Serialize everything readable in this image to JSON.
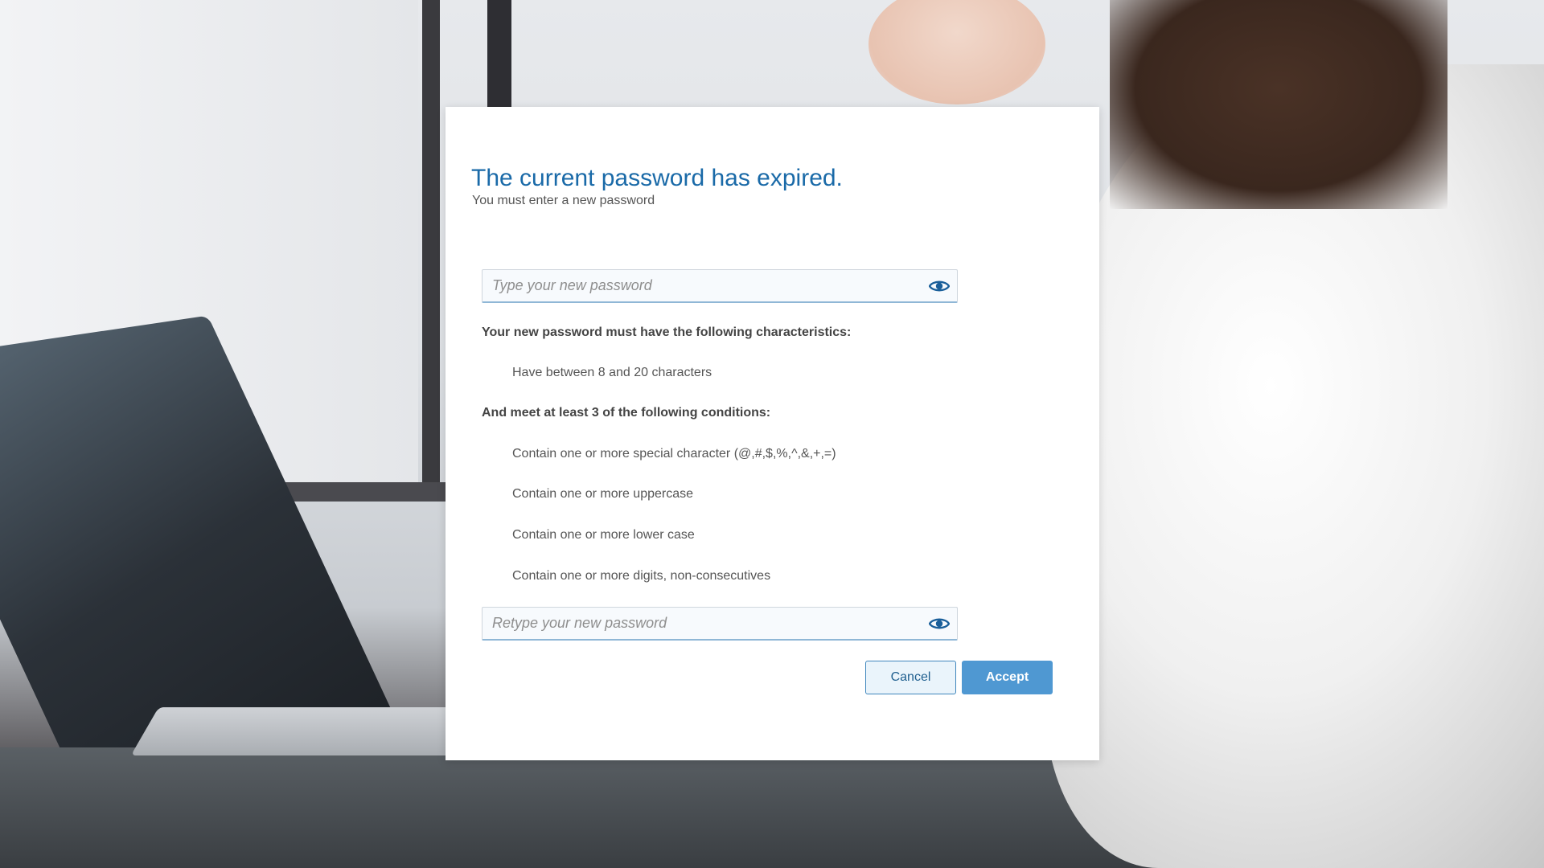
{
  "dialog": {
    "title": "The current password has expired.",
    "subtitle": "You must enter a new password",
    "new_password": {
      "value": "",
      "placeholder": "Type your new password",
      "toggle_icon": "eye-icon"
    },
    "requirements_heading": "Your new password must have the following characteristics:",
    "requirements": [
      "Have between 8 and 20 characters"
    ],
    "conditions_heading": "And meet at least 3 of the following conditions:",
    "conditions": [
      "Contain one or more special character (@,#,$,%,^,&,+,=)",
      "Contain one or more uppercase",
      "Contain one or more lower case",
      "Contain one or more digits, non-consecutives"
    ],
    "retype_password": {
      "value": "",
      "placeholder": "Retype your new password",
      "toggle_icon": "eye-icon"
    },
    "buttons": {
      "cancel": "Cancel",
      "accept": "Accept"
    }
  },
  "colors": {
    "title": "#1a6aa8",
    "accent": "#4f98d2",
    "eye_icon": "#1a5f9a"
  }
}
